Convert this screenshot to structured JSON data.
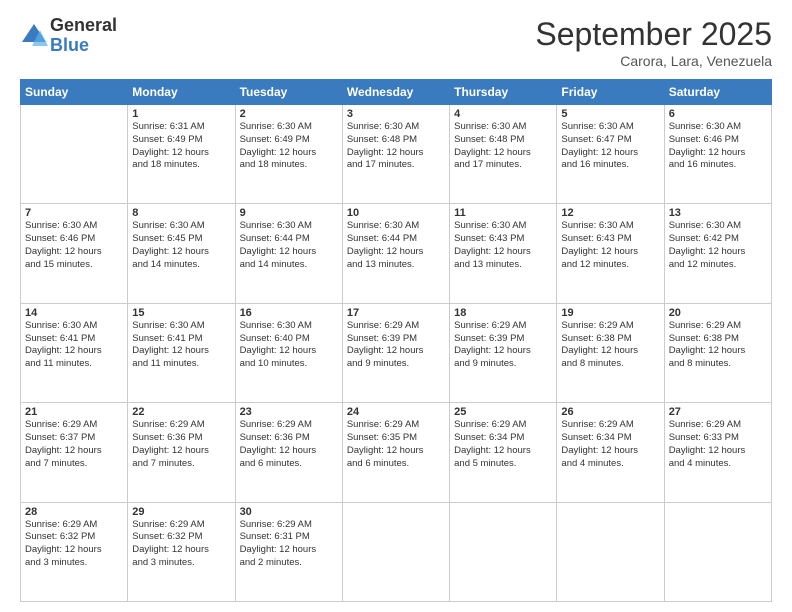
{
  "logo": {
    "general": "General",
    "blue": "Blue"
  },
  "header": {
    "month": "September 2025",
    "location": "Carora, Lara, Venezuela"
  },
  "days": [
    "Sunday",
    "Monday",
    "Tuesday",
    "Wednesday",
    "Thursday",
    "Friday",
    "Saturday"
  ],
  "weeks": [
    [
      {
        "date": "",
        "info": ""
      },
      {
        "date": "1",
        "info": "Sunrise: 6:31 AM\nSunset: 6:49 PM\nDaylight: 12 hours\nand 18 minutes."
      },
      {
        "date": "2",
        "info": "Sunrise: 6:30 AM\nSunset: 6:49 PM\nDaylight: 12 hours\nand 18 minutes."
      },
      {
        "date": "3",
        "info": "Sunrise: 6:30 AM\nSunset: 6:48 PM\nDaylight: 12 hours\nand 17 minutes."
      },
      {
        "date": "4",
        "info": "Sunrise: 6:30 AM\nSunset: 6:48 PM\nDaylight: 12 hours\nand 17 minutes."
      },
      {
        "date": "5",
        "info": "Sunrise: 6:30 AM\nSunset: 6:47 PM\nDaylight: 12 hours\nand 16 minutes."
      },
      {
        "date": "6",
        "info": "Sunrise: 6:30 AM\nSunset: 6:46 PM\nDaylight: 12 hours\nand 16 minutes."
      }
    ],
    [
      {
        "date": "7",
        "info": "Sunrise: 6:30 AM\nSunset: 6:46 PM\nDaylight: 12 hours\nand 15 minutes."
      },
      {
        "date": "8",
        "info": "Sunrise: 6:30 AM\nSunset: 6:45 PM\nDaylight: 12 hours\nand 14 minutes."
      },
      {
        "date": "9",
        "info": "Sunrise: 6:30 AM\nSunset: 6:44 PM\nDaylight: 12 hours\nand 14 minutes."
      },
      {
        "date": "10",
        "info": "Sunrise: 6:30 AM\nSunset: 6:44 PM\nDaylight: 12 hours\nand 13 minutes."
      },
      {
        "date": "11",
        "info": "Sunrise: 6:30 AM\nSunset: 6:43 PM\nDaylight: 12 hours\nand 13 minutes."
      },
      {
        "date": "12",
        "info": "Sunrise: 6:30 AM\nSunset: 6:43 PM\nDaylight: 12 hours\nand 12 minutes."
      },
      {
        "date": "13",
        "info": "Sunrise: 6:30 AM\nSunset: 6:42 PM\nDaylight: 12 hours\nand 12 minutes."
      }
    ],
    [
      {
        "date": "14",
        "info": "Sunrise: 6:30 AM\nSunset: 6:41 PM\nDaylight: 12 hours\nand 11 minutes."
      },
      {
        "date": "15",
        "info": "Sunrise: 6:30 AM\nSunset: 6:41 PM\nDaylight: 12 hours\nand 11 minutes."
      },
      {
        "date": "16",
        "info": "Sunrise: 6:30 AM\nSunset: 6:40 PM\nDaylight: 12 hours\nand 10 minutes."
      },
      {
        "date": "17",
        "info": "Sunrise: 6:29 AM\nSunset: 6:39 PM\nDaylight: 12 hours\nand 9 minutes."
      },
      {
        "date": "18",
        "info": "Sunrise: 6:29 AM\nSunset: 6:39 PM\nDaylight: 12 hours\nand 9 minutes."
      },
      {
        "date": "19",
        "info": "Sunrise: 6:29 AM\nSunset: 6:38 PM\nDaylight: 12 hours\nand 8 minutes."
      },
      {
        "date": "20",
        "info": "Sunrise: 6:29 AM\nSunset: 6:38 PM\nDaylight: 12 hours\nand 8 minutes."
      }
    ],
    [
      {
        "date": "21",
        "info": "Sunrise: 6:29 AM\nSunset: 6:37 PM\nDaylight: 12 hours\nand 7 minutes."
      },
      {
        "date": "22",
        "info": "Sunrise: 6:29 AM\nSunset: 6:36 PM\nDaylight: 12 hours\nand 7 minutes."
      },
      {
        "date": "23",
        "info": "Sunrise: 6:29 AM\nSunset: 6:36 PM\nDaylight: 12 hours\nand 6 minutes."
      },
      {
        "date": "24",
        "info": "Sunrise: 6:29 AM\nSunset: 6:35 PM\nDaylight: 12 hours\nand 6 minutes."
      },
      {
        "date": "25",
        "info": "Sunrise: 6:29 AM\nSunset: 6:34 PM\nDaylight: 12 hours\nand 5 minutes."
      },
      {
        "date": "26",
        "info": "Sunrise: 6:29 AM\nSunset: 6:34 PM\nDaylight: 12 hours\nand 4 minutes."
      },
      {
        "date": "27",
        "info": "Sunrise: 6:29 AM\nSunset: 6:33 PM\nDaylight: 12 hours\nand 4 minutes."
      }
    ],
    [
      {
        "date": "28",
        "info": "Sunrise: 6:29 AM\nSunset: 6:32 PM\nDaylight: 12 hours\nand 3 minutes."
      },
      {
        "date": "29",
        "info": "Sunrise: 6:29 AM\nSunset: 6:32 PM\nDaylight: 12 hours\nand 3 minutes."
      },
      {
        "date": "30",
        "info": "Sunrise: 6:29 AM\nSunset: 6:31 PM\nDaylight: 12 hours\nand 2 minutes."
      },
      {
        "date": "",
        "info": ""
      },
      {
        "date": "",
        "info": ""
      },
      {
        "date": "",
        "info": ""
      },
      {
        "date": "",
        "info": ""
      }
    ]
  ]
}
